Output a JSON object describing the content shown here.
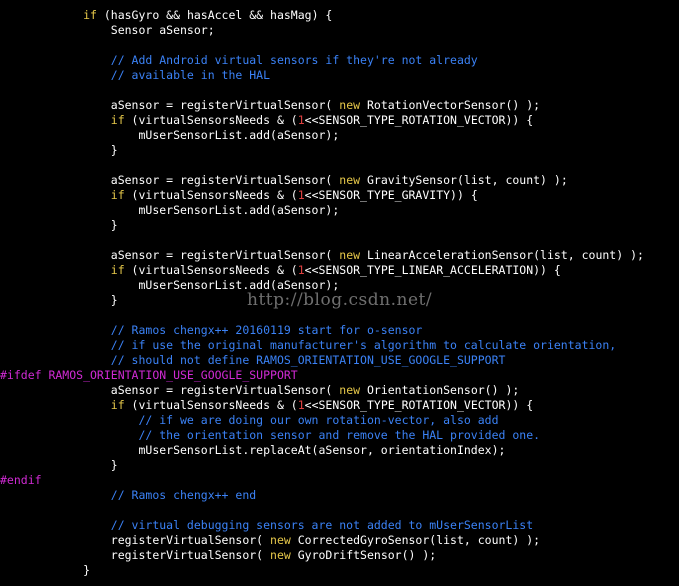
{
  "colors": {
    "background": "#000000",
    "text": "#ffffff",
    "keyword": "#e6c84a",
    "comment": "#3b82f6",
    "preprocessor": "#d02ad4",
    "number": "#e04040"
  },
  "watermark": "http://blog.csdn.net/",
  "code": {
    "lines": [
      [
        {
          "t": "kw",
          "s": "            if"
        },
        {
          "t": "txt",
          "s": " (hasGyro && hasAccel && hasMag) {"
        }
      ],
      [
        {
          "t": "txt",
          "s": "                Sensor aSensor;"
        }
      ],
      [],
      [
        {
          "t": "cm",
          "s": "                // Add Android virtual sensors if they're not already"
        }
      ],
      [
        {
          "t": "cm",
          "s": "                // available in the HAL"
        }
      ],
      [],
      [
        {
          "t": "txt",
          "s": "                aSensor = registerVirtualSensor( "
        },
        {
          "t": "kw",
          "s": "new"
        },
        {
          "t": "txt",
          "s": " RotationVectorSensor() );"
        }
      ],
      [
        {
          "t": "kw",
          "s": "                if"
        },
        {
          "t": "txt",
          "s": " (virtualSensorsNeeds & ("
        },
        {
          "t": "num",
          "s": "1"
        },
        {
          "t": "txt",
          "s": "<<SENSOR_TYPE_ROTATION_VECTOR)) {"
        }
      ],
      [
        {
          "t": "txt",
          "s": "                    mUserSensorList.add(aSensor);"
        }
      ],
      [
        {
          "t": "txt",
          "s": "                }"
        }
      ],
      [],
      [
        {
          "t": "txt",
          "s": "                aSensor = registerVirtualSensor( "
        },
        {
          "t": "kw",
          "s": "new"
        },
        {
          "t": "txt",
          "s": " GravitySensor(list, count) );"
        }
      ],
      [
        {
          "t": "kw",
          "s": "                if"
        },
        {
          "t": "txt",
          "s": " (virtualSensorsNeeds & ("
        },
        {
          "t": "num",
          "s": "1"
        },
        {
          "t": "txt",
          "s": "<<SENSOR_TYPE_GRAVITY)) {"
        }
      ],
      [
        {
          "t": "txt",
          "s": "                    mUserSensorList.add(aSensor);"
        }
      ],
      [
        {
          "t": "txt",
          "s": "                }"
        }
      ],
      [],
      [
        {
          "t": "txt",
          "s": "                aSensor = registerVirtualSensor( "
        },
        {
          "t": "kw",
          "s": "new"
        },
        {
          "t": "txt",
          "s": " LinearAccelerationSensor(list, count) );"
        }
      ],
      [
        {
          "t": "kw",
          "s": "                if"
        },
        {
          "t": "txt",
          "s": " (virtualSensorsNeeds & ("
        },
        {
          "t": "num",
          "s": "1"
        },
        {
          "t": "txt",
          "s": "<<SENSOR_TYPE_LINEAR_ACCELERATION)) {"
        }
      ],
      [
        {
          "t": "txt",
          "s": "                    mUserSensorList.add(aSensor);"
        }
      ],
      [
        {
          "t": "txt",
          "s": "                }"
        }
      ],
      [],
      [
        {
          "t": "cm",
          "s": "                // Ramos chengx++ 20160119 start for o-sensor"
        }
      ],
      [
        {
          "t": "cm",
          "s": "                // if use the original manufacturer's algorithm to calculate orientation,"
        }
      ],
      [
        {
          "t": "cm",
          "s": "                // should not define RAMOS_ORIENTATION_USE_GOOGLE_SUPPORT"
        }
      ],
      [
        {
          "t": "pp",
          "s": "#ifdef RAMOS_ORIENTATION_USE_GOOGLE_SUPPORT"
        }
      ],
      [
        {
          "t": "txt",
          "s": "                aSensor = registerVirtualSensor( "
        },
        {
          "t": "kw",
          "s": "new"
        },
        {
          "t": "txt",
          "s": " OrientationSensor() );"
        }
      ],
      [
        {
          "t": "kw",
          "s": "                if"
        },
        {
          "t": "txt",
          "s": " (virtualSensorsNeeds & ("
        },
        {
          "t": "num",
          "s": "1"
        },
        {
          "t": "txt",
          "s": "<<SENSOR_TYPE_ROTATION_VECTOR)) {"
        }
      ],
      [
        {
          "t": "cm",
          "s": "                    // if we are doing our own rotation-vector, also add"
        }
      ],
      [
        {
          "t": "cm",
          "s": "                    // the orientation sensor and remove the HAL provided one."
        }
      ],
      [
        {
          "t": "txt",
          "s": "                    mUserSensorList.replaceAt(aSensor, orientationIndex);"
        }
      ],
      [
        {
          "t": "txt",
          "s": "                }"
        }
      ],
      [
        {
          "t": "pp",
          "s": "#endif"
        }
      ],
      [
        {
          "t": "cm",
          "s": "                // Ramos chengx++ end"
        }
      ],
      [],
      [
        {
          "t": "cm",
          "s": "                // virtual debugging sensors are not added to mUserSensorList"
        }
      ],
      [
        {
          "t": "txt",
          "s": "                registerVirtualSensor( "
        },
        {
          "t": "kw",
          "s": "new"
        },
        {
          "t": "txt",
          "s": " CorrectedGyroSensor(list, count) );"
        }
      ],
      [
        {
          "t": "txt",
          "s": "                registerVirtualSensor( "
        },
        {
          "t": "kw",
          "s": "new"
        },
        {
          "t": "txt",
          "s": " GyroDriftSensor() );"
        }
      ],
      [
        {
          "t": "txt",
          "s": "            }"
        }
      ]
    ]
  }
}
